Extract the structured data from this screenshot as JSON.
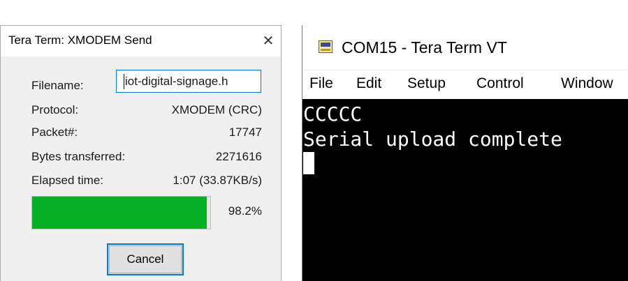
{
  "xmodem_dialog": {
    "title": "Tera Term: XMODEM Send",
    "close_glyph": "✕",
    "fields": {
      "filename": {
        "label": "Filename:",
        "value": "iot-digital-signage.h"
      },
      "protocol": {
        "label": "Protocol:",
        "value": "XMODEM (CRC)"
      },
      "packet": {
        "label": "Packet#:",
        "value": "17747"
      },
      "bytes": {
        "label": "Bytes transferred:",
        "value": "2271616"
      },
      "elapsed": {
        "label": "Elapsed time:",
        "value": "1:07 (33.87KB/s)"
      }
    },
    "progress": {
      "percent": 98.2,
      "label": "98.2%",
      "color": "#06b025"
    },
    "cancel_label": "Cancel"
  },
  "vt_window": {
    "icon": "tera-term-vt-icon",
    "title": "COM15 - Tera Term VT",
    "menu": [
      "File",
      "Edit",
      "Setup",
      "Control",
      "Window"
    ],
    "terminal_lines": [
      "CCCCC",
      "Serial upload complete"
    ]
  }
}
